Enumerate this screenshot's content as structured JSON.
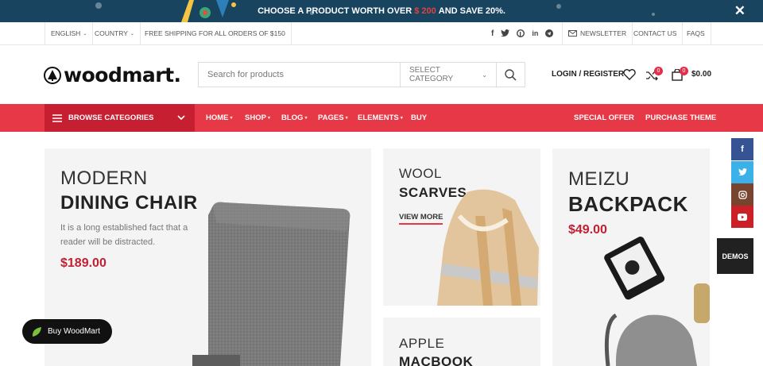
{
  "promo": {
    "text_before": "CHOOSE A PRODUCT WORTH OVER",
    "price": "$ 200",
    "text_after": "AND SAVE 20%.",
    "close_label": "✕"
  },
  "topbar": {
    "language": "ENGLISH",
    "country": "COUNTRY",
    "shipping": "FREE SHIPPING FOR ALL ORDERS OF $150",
    "newsletter": "NEWSLETTER",
    "contact": "CONTACT US",
    "faqs": "FAQS"
  },
  "header": {
    "logo": "woodmart.",
    "search_placeholder": "Search for products",
    "select_category": "SELECT CATEGORY",
    "login": "LOGIN / REGISTER",
    "compare_count": "0",
    "cart_count": "0",
    "cart_total": "$0.00"
  },
  "nav": {
    "browse": "BROWSE CATEGORIES",
    "items": [
      "HOME",
      "SHOP",
      "BLOG",
      "PAGES",
      "ELEMENTS",
      "BUY"
    ],
    "special_offer": "SPECIAL OFFER",
    "purchase": "PURCHASE THEME"
  },
  "cards": {
    "chair": {
      "t1": "MODERN",
      "t2": "DINING CHAIR",
      "desc": "It is a long established fact that a reader will be distracted.",
      "price": "$189.00"
    },
    "scarves": {
      "t1": "WOOL",
      "t2": "SCARVES",
      "link": "VIEW MORE"
    },
    "backpack": {
      "t1": "MEIZU",
      "t2": "BACKPACK",
      "price": "$49.00"
    },
    "macbook": {
      "t1": "APPLE",
      "t2": "MACBOOK"
    }
  },
  "side": {
    "facebook": "f",
    "demos": "DEMOS"
  },
  "buy_button": "Buy WoodMart",
  "colors": {
    "accent": "#e63846",
    "dark_red": "#c71f32",
    "promo_bg": "#18445f"
  }
}
